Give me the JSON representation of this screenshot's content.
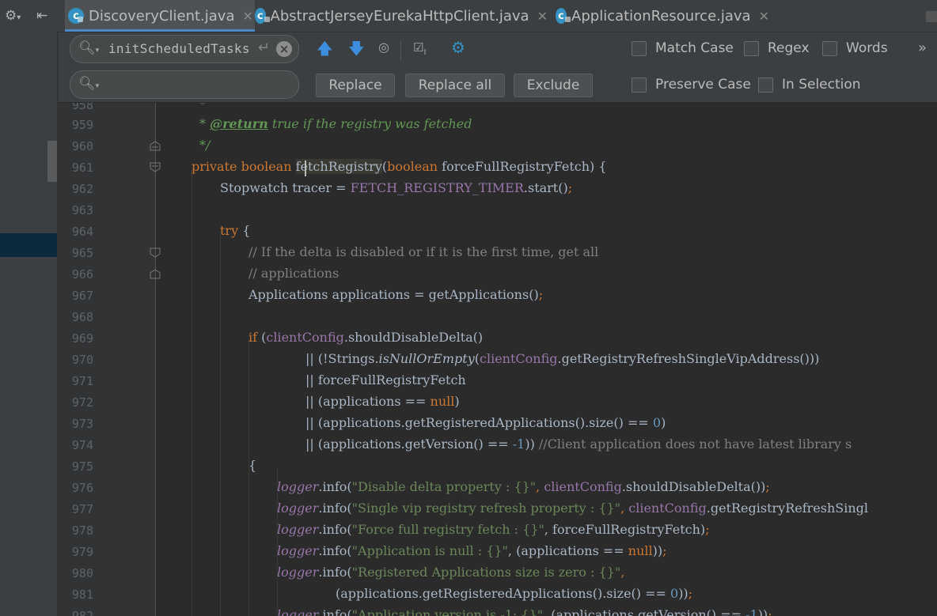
{
  "tabs": [
    {
      "label": "DiscoveryClient.java",
      "icon": "class-icon",
      "active": true
    },
    {
      "label": "AbstractJerseyEurekaHttpClient.java",
      "icon": "class-icon",
      "active": false
    },
    {
      "label": "ApplicationResource.java",
      "icon": "class-icon",
      "active": false
    }
  ],
  "find": {
    "search_value": "initScheduledTasks",
    "replace_value": "",
    "match_case": "Match Case",
    "regex": "Regex",
    "words": "Words",
    "preserve_case": "Preserve Case",
    "in_selection": "In Selection",
    "replace_label": "Replace",
    "replace_all_label": "Replace all",
    "exclude_label": "Exclude",
    "more": "»"
  },
  "colors": {
    "accent": "#4a88c7",
    "keyword": "#cc7832",
    "string": "#6a8759",
    "field": "#9876aa",
    "number": "#6897bb",
    "doc": "#629755"
  },
  "lines": [
    "958",
    "959",
    "960",
    "961",
    "962",
    "963",
    "964",
    "965",
    "966",
    "967",
    "968",
    "969",
    "970",
    "971",
    "972",
    "973",
    "974",
    "975",
    "976",
    "977",
    "978",
    "979",
    "980",
    "981",
    "982"
  ],
  "code": {
    "l958": "*",
    "l959_star": "* ",
    "l959_tag": "@return",
    "l959_rest": " true if the registry was fetched",
    "l960": "*/",
    "l961_kw1": "private",
    "l961_kw2": "boolean",
    "l961_name": "fetchRegistry",
    "l961_paren": "(",
    "l961_kw3": "boolean",
    "l961_rest": " forceFullRegistryFetch) {",
    "l962_a": "Stopwatch tracer = ",
    "l962_f": "FETCH_REGISTRY_TIMER",
    "l962_b": ".start()",
    "l962_semi": ";",
    "l964_kw": "try",
    "l964_b": " {",
    "l965": "// If the delta is disabled or if it is the first time, get all",
    "l966": "// applications",
    "l967_a": "Applications applications = getApplications()",
    "l967_semi": ";",
    "l969_kw": "if",
    "l969_a": " (",
    "l969_f": "clientConfig",
    "l969_b": ".shouldDisableDelta()",
    "l970_a": "|| (!Strings.",
    "l970_it": "isNullOrEmpty",
    "l970_b": "(",
    "l970_f": "clientConfig",
    "l970_c": ".getRegistryRefreshSingleVipAddress()))",
    "l971": "|| forceFullRegistryFetch",
    "l972_a": "|| (applications == ",
    "l972_kw": "null",
    "l972_b": ")",
    "l973_a": "|| (applications.getRegisteredApplications().size() == ",
    "l973_n": "0",
    "l973_b": ")",
    "l974_a": "|| (applications.getVersion() == ",
    "l974_n": "-1",
    "l974_b": ")) ",
    "l974_cm": "//Client application does not have latest library s",
    "l975": "{",
    "l976_lg": "logger",
    "l976_a": ".info(",
    "l976_s": "\"Disable delta property : {}\"",
    "l976_c": ", ",
    "l976_f": "clientConfig",
    "l976_d": ".shouldDisableDelta())",
    "l976_semi": ";",
    "l977_lg": "logger",
    "l977_a": ".info(",
    "l977_s": "\"Single vip registry refresh property : {}\"",
    "l977_c": ", ",
    "l977_f": "clientConfig",
    "l977_d": ".getRegistryRefreshSingl",
    "l978_lg": "logger",
    "l978_a": ".info(",
    "l978_s": "\"Force full registry fetch : {}\"",
    "l978_c": ", forceFullRegistryFetch)",
    "l978_semi": ";",
    "l979_lg": "logger",
    "l979_a": ".info(",
    "l979_s": "\"Application is null : {}\"",
    "l979_c": ", (applications == ",
    "l979_kw": "null",
    "l979_d": "))",
    "l979_semi": ";",
    "l980_lg": "logger",
    "l980_a": ".info(",
    "l980_s": "\"Registered Applications size is zero : {}\"",
    "l980_c": ",",
    "l981_a": "(applications.getRegisteredApplications().size() == ",
    "l981_n": "0",
    "l981_b": "))",
    "l981_semi": ";",
    "l982_lg": "logger",
    "l982_a": ".info(",
    "l982_s": "\"Application version is -1: {}\"",
    "l982_c": ", (applications.getVersion() == ",
    "l982_n": "-1",
    "l982_d": "))",
    "l982_semi": ";"
  }
}
